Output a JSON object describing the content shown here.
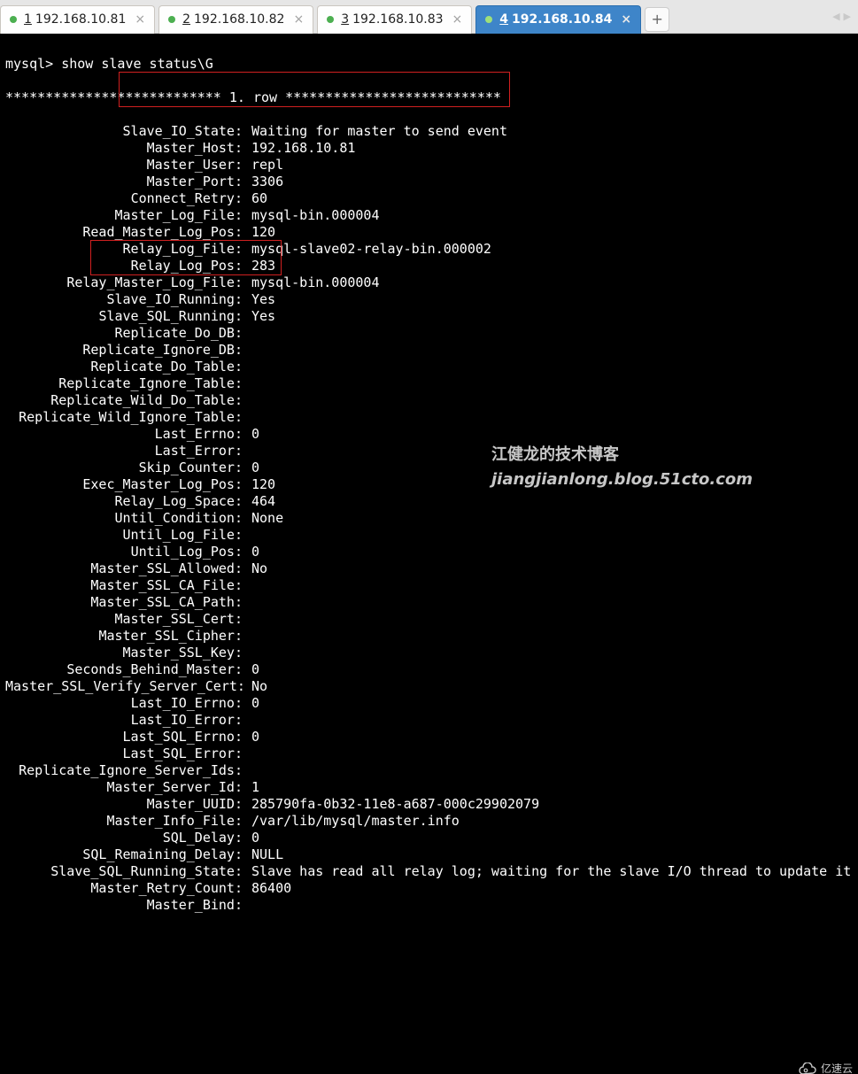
{
  "tabs": [
    {
      "num": "1",
      "label": "192.168.10.81",
      "active": false
    },
    {
      "num": "2",
      "label": "192.168.10.82",
      "active": false
    },
    {
      "num": "3",
      "label": "192.168.10.83",
      "active": false
    },
    {
      "num": "4",
      "label": "192.168.10.84",
      "active": true
    }
  ],
  "newtab_label": "+",
  "terminal": {
    "prompt_line": "mysql> show slave status\\G",
    "row_header": "*************************** 1. row ***************************",
    "fields": [
      {
        "label": "Slave_IO_State:",
        "value": "Waiting for master to send event"
      },
      {
        "label": "Master_Host:",
        "value": "192.168.10.81"
      },
      {
        "label": "Master_User:",
        "value": "repl"
      },
      {
        "label": "Master_Port:",
        "value": "3306"
      },
      {
        "label": "Connect_Retry:",
        "value": "60"
      },
      {
        "label": "Master_Log_File:",
        "value": "mysql-bin.000004"
      },
      {
        "label": "Read_Master_Log_Pos:",
        "value": "120"
      },
      {
        "label": "Relay_Log_File:",
        "value": "mysql-slave02-relay-bin.000002"
      },
      {
        "label": "Relay_Log_Pos:",
        "value": "283"
      },
      {
        "label": "Relay_Master_Log_File:",
        "value": "mysql-bin.000004"
      },
      {
        "label": "Slave_IO_Running:",
        "value": "Yes"
      },
      {
        "label": "Slave_SQL_Running:",
        "value": "Yes"
      },
      {
        "label": "Replicate_Do_DB:",
        "value": ""
      },
      {
        "label": "Replicate_Ignore_DB:",
        "value": ""
      },
      {
        "label": "Replicate_Do_Table:",
        "value": ""
      },
      {
        "label": "Replicate_Ignore_Table:",
        "value": ""
      },
      {
        "label": "Replicate_Wild_Do_Table:",
        "value": ""
      },
      {
        "label": "Replicate_Wild_Ignore_Table:",
        "value": ""
      },
      {
        "label": "Last_Errno:",
        "value": "0"
      },
      {
        "label": "Last_Error:",
        "value": ""
      },
      {
        "label": "Skip_Counter:",
        "value": "0"
      },
      {
        "label": "Exec_Master_Log_Pos:",
        "value": "120"
      },
      {
        "label": "Relay_Log_Space:",
        "value": "464"
      },
      {
        "label": "Until_Condition:",
        "value": "None"
      },
      {
        "label": "Until_Log_File:",
        "value": ""
      },
      {
        "label": "Until_Log_Pos:",
        "value": "0"
      },
      {
        "label": "Master_SSL_Allowed:",
        "value": "No"
      },
      {
        "label": "Master_SSL_CA_File:",
        "value": ""
      },
      {
        "label": "Master_SSL_CA_Path:",
        "value": ""
      },
      {
        "label": "Master_SSL_Cert:",
        "value": ""
      },
      {
        "label": "Master_SSL_Cipher:",
        "value": ""
      },
      {
        "label": "Master_SSL_Key:",
        "value": ""
      },
      {
        "label": "Seconds_Behind_Master:",
        "value": "0"
      },
      {
        "label": "Master_SSL_Verify_Server_Cert:",
        "value": "No"
      },
      {
        "label": "Last_IO_Errno:",
        "value": "0"
      },
      {
        "label": "Last_IO_Error:",
        "value": ""
      },
      {
        "label": "Last_SQL_Errno:",
        "value": "0"
      },
      {
        "label": "Last_SQL_Error:",
        "value": ""
      },
      {
        "label": "Replicate_Ignore_Server_Ids:",
        "value": ""
      },
      {
        "label": "Master_Server_Id:",
        "value": "1"
      },
      {
        "label": "Master_UUID:",
        "value": "285790fa-0b32-11e8-a687-000c29902079"
      },
      {
        "label": "Master_Info_File:",
        "value": "/var/lib/mysql/master.info"
      },
      {
        "label": "SQL_Delay:",
        "value": "0"
      },
      {
        "label": "SQL_Remaining_Delay:",
        "value": "NULL"
      },
      {
        "label": "Slave_SQL_Running_State:",
        "value": "Slave has read all relay log; waiting for the slave I/O thread to update it"
      },
      {
        "label": "Master_Retry_Count:",
        "value": "86400"
      },
      {
        "label": "Master_Bind:",
        "value": ""
      }
    ]
  },
  "watermark": {
    "line1": "江健龙的技术博客",
    "line2": "jiangjianlong.blog.51cto.com"
  },
  "corner_logo_text": "亿速云",
  "scroll_arrows": {
    "left": "◀",
    "right": "▶"
  }
}
